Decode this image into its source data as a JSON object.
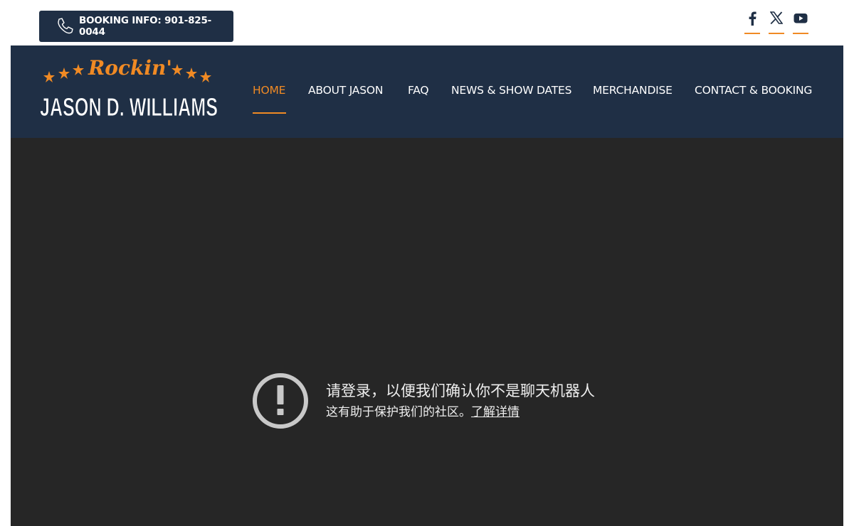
{
  "topbar": {
    "booking_label": "BOOKING INFO: 901-825-0044",
    "social": [
      "facebook-icon",
      "x-icon",
      "youtube-icon"
    ]
  },
  "logo": {
    "script_text": "Rockin'",
    "name_text": "JASON D. WILLIAMS"
  },
  "nav": {
    "items": [
      {
        "label": "HOME",
        "active": true
      },
      {
        "label": "ABOUT JASON"
      },
      {
        "label": "FAQ"
      },
      {
        "label": "NEWS & SHOW DATES"
      },
      {
        "label": "MERCHANDISE"
      },
      {
        "label": "CONTACT & BOOKING"
      }
    ]
  },
  "notice": {
    "title": "请登录，以便我们确认你不是聊天机器人",
    "body": "这有助于保护我们的社区。",
    "link": "了解详情"
  },
  "colors": {
    "navy": "#1f2f45",
    "accent": "#f08a24",
    "content_bg": "#262626",
    "icon_gray": "#c8c8c8"
  }
}
